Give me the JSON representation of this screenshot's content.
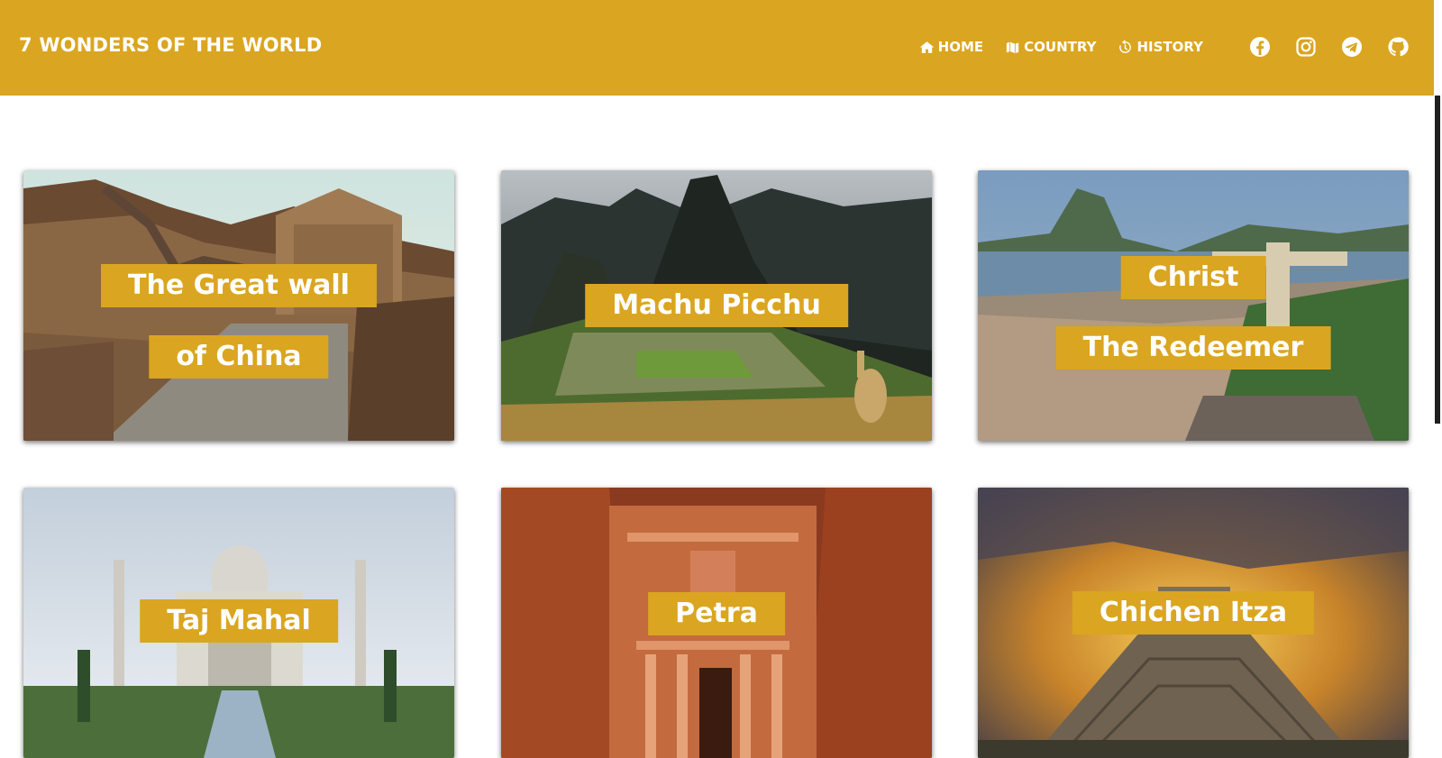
{
  "header": {
    "brand": "7 WONDERS OF THE WORLD",
    "bg_color": "#DAA520",
    "nav": [
      {
        "label": "HOME",
        "icon": "home-icon"
      },
      {
        "label": "COUNTRY",
        "icon": "map-icon"
      },
      {
        "label": "HISTORY",
        "icon": "history-icon"
      }
    ],
    "social": [
      "facebook-icon",
      "instagram-icon",
      "telegram-icon",
      "github-icon"
    ]
  },
  "cards": [
    {
      "lines": [
        "The Great wall",
        "of China"
      ]
    },
    {
      "lines": [
        "Machu Picchu"
      ]
    },
    {
      "lines": [
        "Christ",
        "The Redeemer"
      ]
    },
    {
      "lines": [
        "Taj Mahal"
      ]
    },
    {
      "lines": [
        "Petra"
      ]
    },
    {
      "lines": [
        "Chichen Itza"
      ]
    }
  ]
}
